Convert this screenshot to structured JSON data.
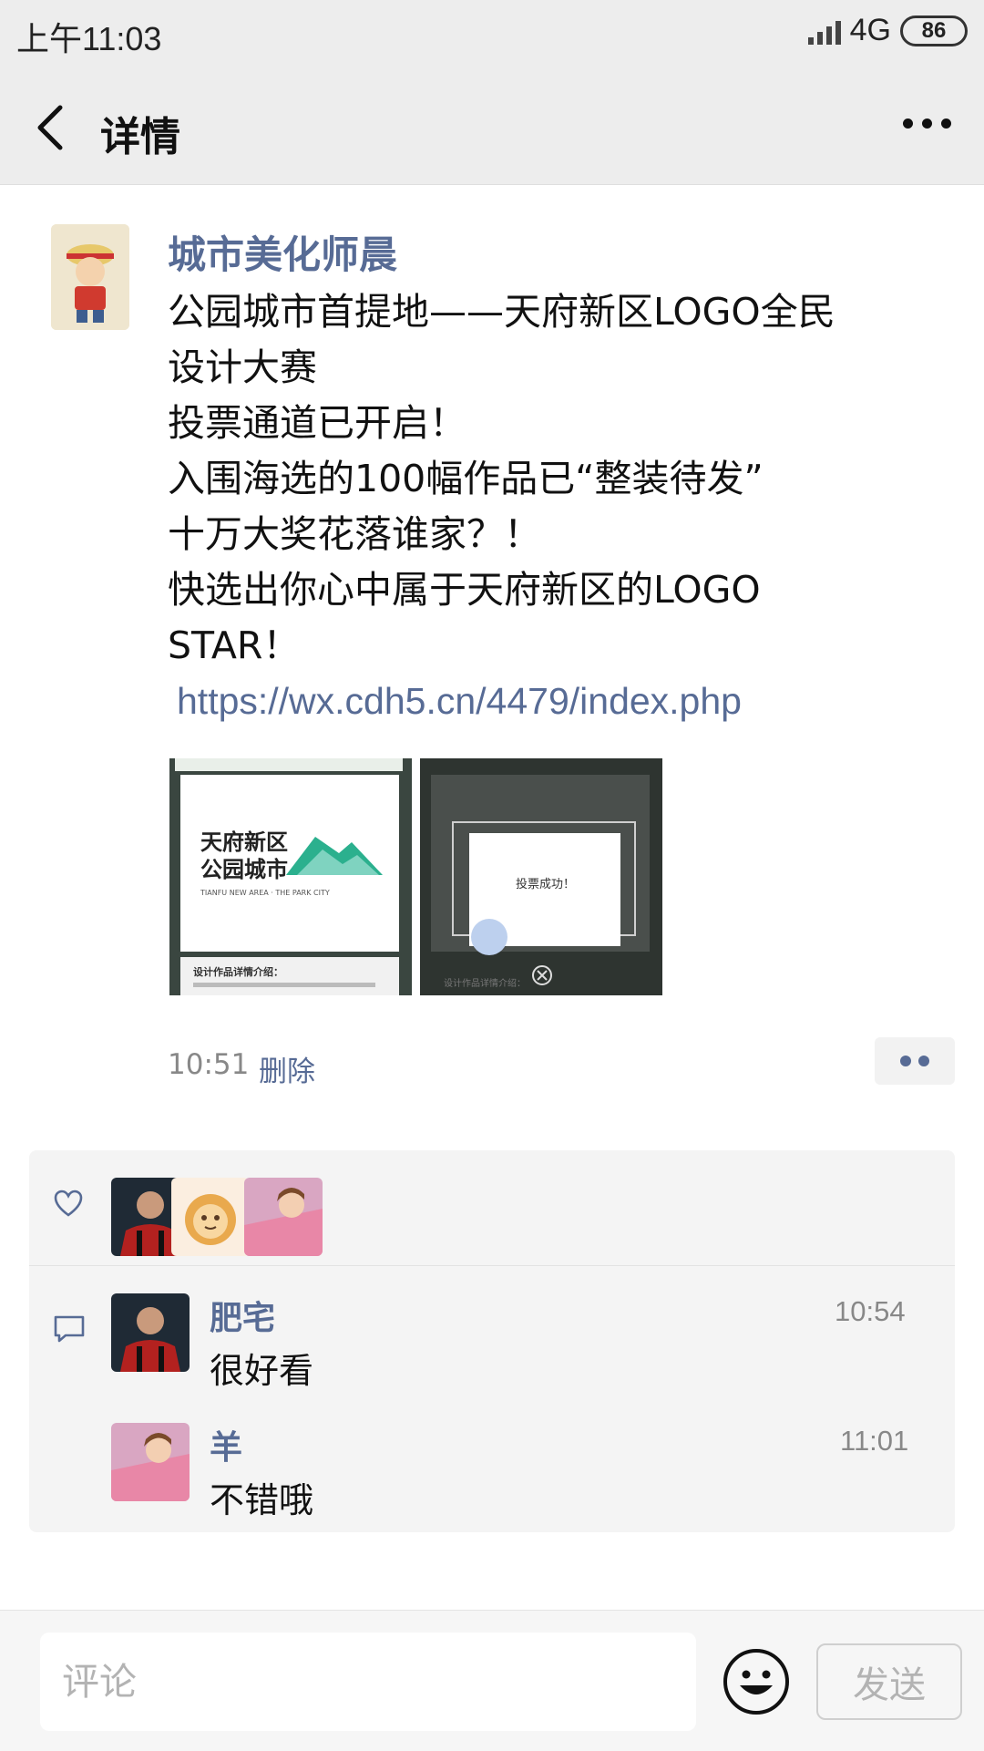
{
  "status_bar": {
    "time": "上午11:03",
    "network": "4G",
    "battery": "86"
  },
  "header": {
    "title": "详情",
    "back_icon": "chevron-left-icon",
    "more_icon": "more-horizontal-icon"
  },
  "post": {
    "author": "城市美化师晨",
    "lines": [
      "公园城市首提地——天府新区LOGO全民",
      "设计大赛",
      "投票通道已开启！",
      "入围海选的100幅作品已“整装待发”",
      "十万大奖花落谁家？！",
      "快选出你心中属于天府新区的LOGO",
      "STAR！"
    ],
    "link": "https://wx.cdh5.cn/4479/index.php",
    "images": [
      {
        "title_line1": "天府新区",
        "title_line2": "公园城市",
        "subtitle": "TIANFU NEW AREA · THE PARK CITY",
        "footer": "设计作品详情介绍："
      },
      {
        "dialog_text": "投票成功！",
        "footer": "设计作品详情介绍："
      }
    ],
    "time": "10:51",
    "delete_label": "删除"
  },
  "likes": {
    "icon": "heart-icon"
  },
  "comments": {
    "icon": "comment-icon",
    "items": [
      {
        "name": "肥宅",
        "text": "很好看",
        "time": "10:54"
      },
      {
        "name": "羊",
        "text": "不错哦",
        "time": "11:01"
      }
    ]
  },
  "footer": {
    "input_placeholder": "评论",
    "emoji_icon": "smiley-icon",
    "send_label": "发送"
  },
  "colors": {
    "link_blue": "#576b95",
    "header_bg": "#ededed",
    "panel_bg": "#f4f4f4"
  }
}
